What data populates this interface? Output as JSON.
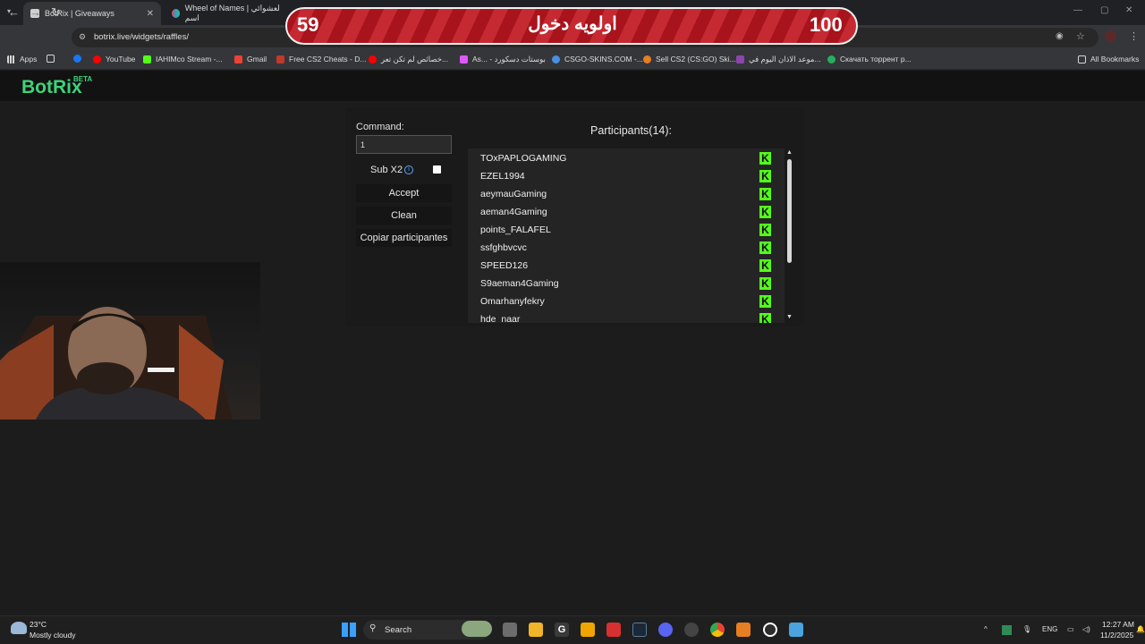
{
  "browser": {
    "tabs": [
      {
        "title": "BotRix | Giveaways",
        "active": true
      },
      {
        "title": "Wheel of Names | لعشوائي اسم",
        "active": false
      }
    ],
    "url": "botrix.live/widgets/raffles/",
    "bookmarks": [
      {
        "label": "Apps",
        "color": "#d6d6d6"
      },
      {
        "label": "YouTube",
        "color": "#ff0000"
      },
      {
        "label": "IAHIMco Stream -...",
        "color": "#53fc18"
      },
      {
        "label": "Gmail",
        "color": "#ea4335"
      },
      {
        "label": "Free CS2 Cheats - D...",
        "color": "#c0392b"
      },
      {
        "label": "خصائص لم تكن تعر...",
        "color": "#ff0000"
      },
      {
        "label": "As... - بوستات دسكورد",
        "color": "#e056fd"
      },
      {
        "label": "CSGO-SKINS.COM -...",
        "color": "#4a90e2"
      },
      {
        "label": "Sell CS2 (CS:GO) Ski...",
        "color": "#e67e22"
      },
      {
        "label": "موعد الاذان اليوم في...",
        "color": "#8e44ad"
      },
      {
        "label": "Скачать торрент р...",
        "color": "#27ae60"
      },
      {
        "label": "All Bookmarks",
        "color": "#d6d6d6"
      }
    ]
  },
  "banner": {
    "left_number": "59",
    "center_text": "اولويه دخول",
    "right_number": "100"
  },
  "app": {
    "logo": "BotRix",
    "badge": "BETA"
  },
  "raffle": {
    "command_label": "Command:",
    "command_value": "1",
    "sub_label": "Sub X2",
    "sub_checked": false,
    "buttons": {
      "accept": "Accept",
      "clean": "Clean",
      "copy": "Copiar participantes"
    },
    "participants_title": "Participants(14):",
    "participants": [
      "TOxPAPLOGAMING",
      "EZEL1994",
      "aeymauGaming",
      "aeman4Gaming",
      "points_FALAFEL",
      "ssfghbvcvc",
      "SPEED126",
      "S9aeman4Gaming",
      "Omarhanyfekry",
      "hde_naar"
    ],
    "platform_icon": "kick-icon",
    "platform_color": "#53fc18"
  },
  "taskbar": {
    "weather_temp": "23°C",
    "weather_desc": "Mostly cloudy",
    "search_label": "Search",
    "language": "ENG",
    "time": "12:27 AM",
    "date": "11/2/2025"
  }
}
